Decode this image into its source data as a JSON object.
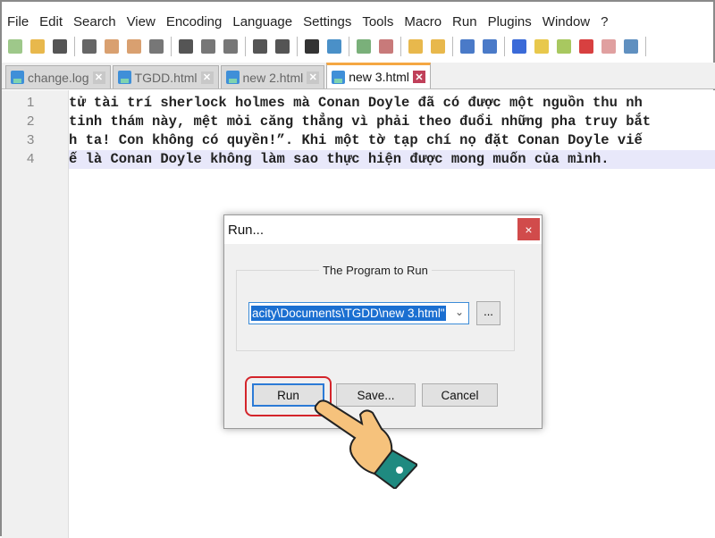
{
  "menu": [
    "File",
    "Edit",
    "Search",
    "View",
    "Encoding",
    "Language",
    "Settings",
    "Tools",
    "Macro",
    "Run",
    "Plugins",
    "Window",
    "?"
  ],
  "toolbar_icons": [
    "new-file",
    "open-file",
    "save",
    "save-all",
    "close",
    "close-all",
    "print",
    "cut",
    "copy",
    "paste",
    "undo",
    "redo",
    "find",
    "replace",
    "zoom-in",
    "zoom-out",
    "sync-vertical",
    "sync-horizontal",
    "word-wrap",
    "show-all-characters",
    "indent-guide",
    "user-defined-language",
    "document-map",
    "function-list",
    "folder-as-workspace",
    "monitoring"
  ],
  "tabs": [
    {
      "label": "change.log",
      "active": false
    },
    {
      "label": "TGDD.html",
      "active": false
    },
    {
      "label": "new 2.html",
      "active": false
    },
    {
      "label": "new 3.html",
      "active": true
    }
  ],
  "editor": {
    "lines": [
      {
        "num": "1",
        "text": "tử tài trí sherlock holmes mà Conan Doyle đã có được một nguồn thu nh"
      },
      {
        "num": "2",
        "text": "tinh thám này, mệt mỏi căng thẳng vì phải theo đuổi những pha truy bắt"
      },
      {
        "num": "3",
        "text": "h ta! Con không có quyền!”. Khi một tờ tạp chí nọ đặt Conan Doyle viế"
      },
      {
        "num": "4",
        "text": "ế là Conan Doyle không làm sao thực hiện được mong muốn của mình."
      }
    ],
    "current_line": 4
  },
  "dialog": {
    "title": "Run...",
    "close": "×",
    "group_label": "The Program to Run",
    "program_value": "acity\\Documents\\TGDD\\new 3.html\"",
    "browse_label": "...",
    "run_label": "Run",
    "save_label": "Save...",
    "cancel_label": "Cancel"
  },
  "colors": {
    "accent": "#1b6fd1",
    "highlight": "#d4252b",
    "tab_active": "#f5a742"
  }
}
